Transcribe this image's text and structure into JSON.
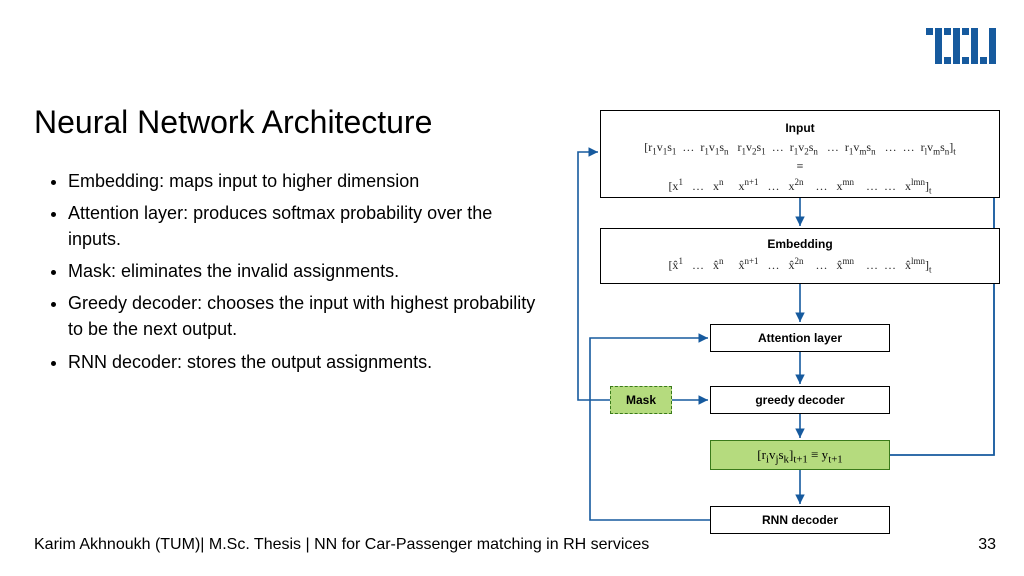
{
  "title": "Neural Network Architecture",
  "bullets": [
    "Embedding: maps input to higher dimension",
    "Attention layer: produces softmax probability over the inputs.",
    "Mask: eliminates the invalid assignments.",
    "Greedy decoder: chooses the input with highest probability to be the next output.",
    "RNN decoder: stores the output assignments."
  ],
  "footer": "Karim Akhnoukh (TUM)| M.Sc. Thesis | NN for Car-Passenger matching in RH services",
  "page": "33",
  "diagram": {
    "input_label": "Input",
    "input_line1_html": "[r<sub>1</sub>v<sub>1</sub>s<sub>1</sub>&nbsp;&nbsp;…&nbsp;&nbsp;r<sub>1</sub>v<sub>1</sub>s<sub>n</sub>&nbsp;&nbsp;&nbsp;r<sub>1</sub>v<sub>2</sub>s<sub>1</sub>&nbsp;&nbsp;…&nbsp;&nbsp;r<sub>1</sub>v<sub>2</sub>s<sub>n</sub>&nbsp;&nbsp;&nbsp;…&nbsp;&nbsp;r<sub>1</sub>v<sub>m</sub>s<sub>n</sub>&nbsp;&nbsp;&nbsp;…&nbsp;&nbsp;…&nbsp;&nbsp;r<sub>l</sub>v<sub>m</sub>s<sub>n</sub>]<sub>t</sub>",
    "input_equiv": "≡",
    "input_line2_html": "[x<sup>1</sup>&nbsp;&nbsp;&nbsp;…&nbsp;&nbsp;&nbsp;x<sup>n</sup>&nbsp;&nbsp;&nbsp;&nbsp;&nbsp;x<sup>n+1</sup>&nbsp;&nbsp;&nbsp;…&nbsp;&nbsp;&nbsp;x<sup>2n</sup>&nbsp;&nbsp;&nbsp;&nbsp;…&nbsp;&nbsp;&nbsp;x<sup>mn</sup>&nbsp;&nbsp;&nbsp;&nbsp;…&nbsp;&nbsp;…&nbsp;&nbsp;&nbsp;x<sup>lmn</sup>]<sub>t</sub>",
    "embed_label": "Embedding",
    "embed_line_html": "[x̂<sup>1</sup>&nbsp;&nbsp;&nbsp;…&nbsp;&nbsp;&nbsp;x̂<sup>n</sup>&nbsp;&nbsp;&nbsp;&nbsp;&nbsp;x̂<sup>n+1</sup>&nbsp;&nbsp;&nbsp;…&nbsp;&nbsp;&nbsp;x̂<sup>2n</sup>&nbsp;&nbsp;&nbsp;&nbsp;…&nbsp;&nbsp;&nbsp;x̂<sup>mn</sup>&nbsp;&nbsp;&nbsp;&nbsp;…&nbsp;&nbsp;…&nbsp;&nbsp;&nbsp;x̂<sup>lmn</sup>]<sub>t</sub>",
    "attention_label": "Attention layer",
    "mask_label": "Mask",
    "greedy_label": "greedy decoder",
    "output_html": "[r<sub>i</sub>v<sub>j</sub>s<sub>k</sub>]<sub>t+1</sub> ≡ y<sub>t+1</sub>",
    "rnn_label": "RNN decoder"
  }
}
